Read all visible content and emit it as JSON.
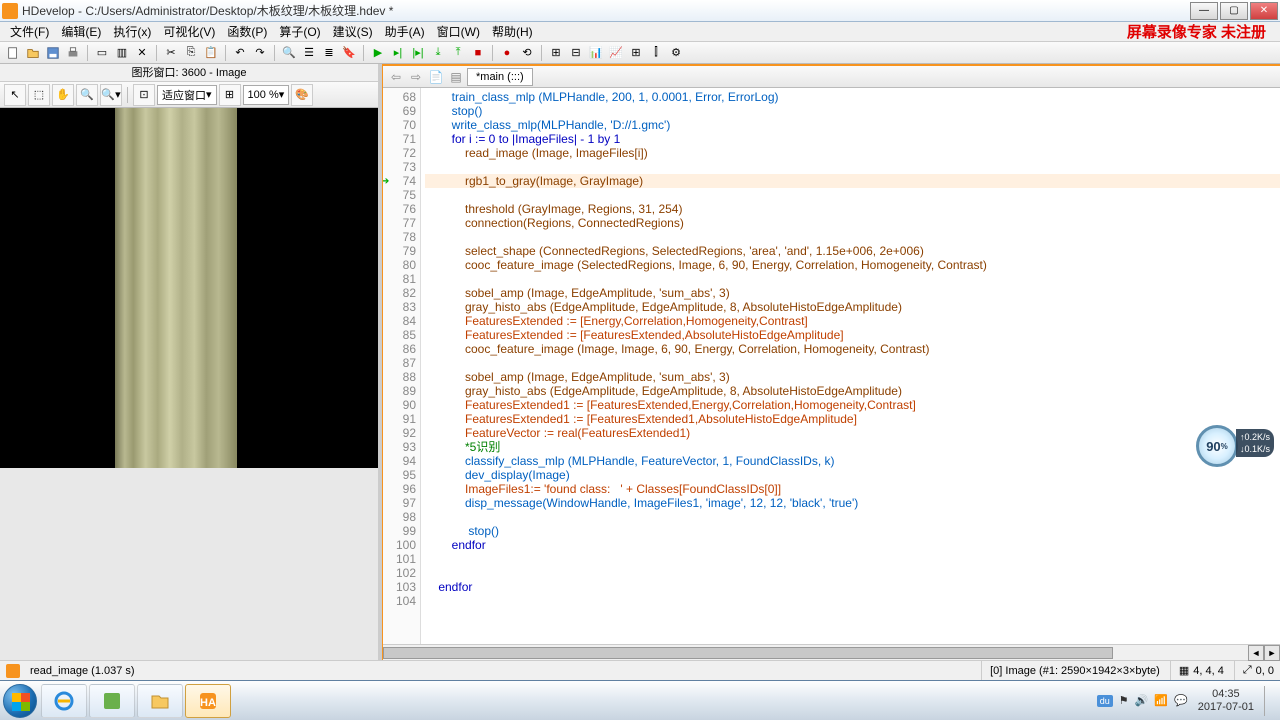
{
  "title": "HDevelop - C:/Users/Administrator/Desktop/木板纹理/木板纹理.hdev *",
  "menus": [
    "文件(F)",
    "编辑(E)",
    "执行(x)",
    "可视化(V)",
    "函数(P)",
    "算子(O)",
    "建议(S)",
    "助手(A)",
    "窗口(W)",
    "帮助(H)"
  ],
  "watermark": "屏幕录像专家 未注册",
  "imgwin": {
    "title": "图形窗口: 3600 - Image",
    "fit": "适应窗口",
    "zoom": "100 %"
  },
  "tab": "*main (:::)",
  "code_start": 68,
  "code": [
    {
      "n": 68,
      "ind": 2,
      "t": "train_class_mlp (MLPHandle, 200, 1, 0.0001, Error, ErrorLog)",
      "cls": "op-blue"
    },
    {
      "n": 69,
      "ind": 2,
      "t": "stop()",
      "cls": "op-blue"
    },
    {
      "n": 70,
      "ind": 2,
      "t": "write_class_mlp(MLPHandle, 'D://1.gmc')",
      "cls": "op-blue"
    },
    {
      "n": 71,
      "ind": 2,
      "t": "for i := 0 to |ImageFiles| - 1 by 1",
      "cls": "kw"
    },
    {
      "n": 72,
      "ind": 3,
      "t": "read_image (Image, ImageFiles[i])",
      "cls": "op-brown"
    },
    {
      "n": 73,
      "ind": 3,
      "t": "",
      "cls": ""
    },
    {
      "n": 74,
      "ind": 3,
      "t": "rgb1_to_gray(Image, GrayImage)",
      "cls": "op-brown",
      "hl": true,
      "cur": true
    },
    {
      "n": 75,
      "ind": 3,
      "t": "",
      "cls": ""
    },
    {
      "n": 76,
      "ind": 3,
      "t": "threshold (GrayImage, Regions, 31, 254)",
      "cls": "op-brown"
    },
    {
      "n": 77,
      "ind": 3,
      "t": "connection(Regions, ConnectedRegions)",
      "cls": "op-brown"
    },
    {
      "n": 78,
      "ind": 3,
      "t": "",
      "cls": ""
    },
    {
      "n": 79,
      "ind": 3,
      "t": "select_shape (ConnectedRegions, SelectedRegions, 'area', 'and', 1.15e+006, 2e+006)",
      "cls": "op-brown"
    },
    {
      "n": 80,
      "ind": 3,
      "t": "cooc_feature_image (SelectedRegions, Image, 6, 90, Energy, Correlation, Homogeneity, Contrast)",
      "cls": "op-brown"
    },
    {
      "n": 81,
      "ind": 3,
      "t": "",
      "cls": ""
    },
    {
      "n": 82,
      "ind": 3,
      "t": "sobel_amp (Image, EdgeAmplitude, 'sum_abs', 3)",
      "cls": "op-brown"
    },
    {
      "n": 83,
      "ind": 3,
      "t": "gray_histo_abs (EdgeAmplitude, EdgeAmplitude, 8, AbsoluteHistoEdgeAmplitude)",
      "cls": "op-brown"
    },
    {
      "n": 84,
      "ind": 3,
      "t": "FeaturesExtended := [Energy,Correlation,Homogeneity,Contrast]",
      "cls": "assign"
    },
    {
      "n": 85,
      "ind": 3,
      "t": "FeaturesExtended := [FeaturesExtended,AbsoluteHistoEdgeAmplitude]",
      "cls": "assign"
    },
    {
      "n": 86,
      "ind": 3,
      "t": "cooc_feature_image (Image, Image, 6, 90, Energy, Correlation, Homogeneity, Contrast)",
      "cls": "op-brown"
    },
    {
      "n": 87,
      "ind": 3,
      "t": "",
      "cls": ""
    },
    {
      "n": 88,
      "ind": 3,
      "t": "sobel_amp (Image, EdgeAmplitude, 'sum_abs', 3)",
      "cls": "op-brown"
    },
    {
      "n": 89,
      "ind": 3,
      "t": "gray_histo_abs (EdgeAmplitude, EdgeAmplitude, 8, AbsoluteHistoEdgeAmplitude)",
      "cls": "op-brown"
    },
    {
      "n": 90,
      "ind": 3,
      "t": "FeaturesExtended1 := [FeaturesExtended,Energy,Correlation,Homogeneity,Contrast]",
      "cls": "assign"
    },
    {
      "n": 91,
      "ind": 3,
      "t": "FeaturesExtended1 := [FeaturesExtended1,AbsoluteHistoEdgeAmplitude]",
      "cls": "assign"
    },
    {
      "n": 92,
      "ind": 3,
      "t": "FeatureVector := real(FeaturesExtended1)",
      "cls": "assign"
    },
    {
      "n": 93,
      "ind": 3,
      "t": "*5识别",
      "cls": "cmt"
    },
    {
      "n": 94,
      "ind": 3,
      "t": "classify_class_mlp (MLPHandle, FeatureVector, 1, FoundClassIDs, k)",
      "cls": "op-blue"
    },
    {
      "n": 95,
      "ind": 3,
      "t": "dev_display(Image)",
      "cls": "op-blue"
    },
    {
      "n": 96,
      "ind": 3,
      "t": "ImageFiles1:= 'found class:   ' + Classes[FoundClassIDs[0]]",
      "cls": "assign"
    },
    {
      "n": 97,
      "ind": 3,
      "t": "disp_message(WindowHandle, ImageFiles1, 'image', 12, 12, 'black', 'true')",
      "cls": "op-blue"
    },
    {
      "n": 98,
      "ind": 3,
      "t": "",
      "cls": ""
    },
    {
      "n": 99,
      "ind": 3,
      "t": " stop()",
      "cls": "op-blue"
    },
    {
      "n": 100,
      "ind": 2,
      "t": "endfor",
      "cls": "kw"
    },
    {
      "n": 101,
      "ind": 0,
      "t": "",
      "cls": ""
    },
    {
      "n": 102,
      "ind": 0,
      "t": "",
      "cls": ""
    },
    {
      "n": 103,
      "ind": 1,
      "t": "endfor",
      "cls": "kw"
    },
    {
      "n": 104,
      "ind": 0,
      "t": "",
      "cls": ""
    }
  ],
  "status": {
    "op": "read_image (1.037 s)",
    "img": "[0] Image (#1: 2590×1942×3×byte)",
    "coord": "4, 4, 4",
    "rc": "0, 0"
  },
  "gauge": {
    "pct": "90",
    "unit": "%",
    "up": "0.2K/s",
    "dn": "0.1K/s"
  },
  "clock": {
    "time": "04:35",
    "date": "2017-07-01"
  }
}
